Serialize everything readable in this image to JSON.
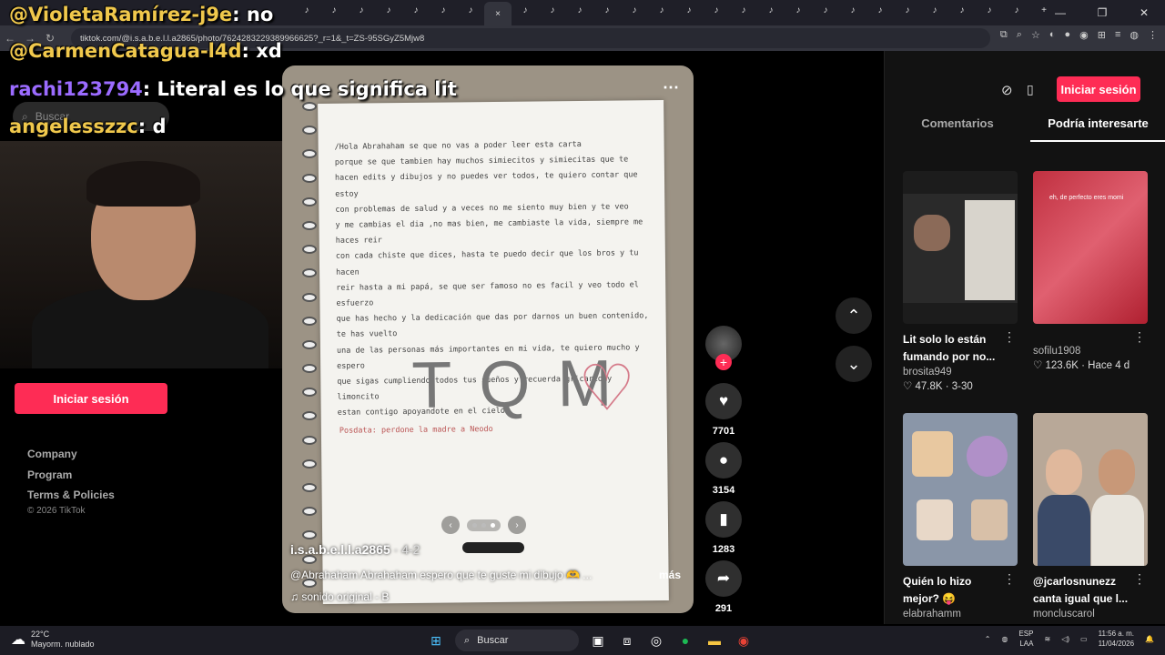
{
  "browser": {
    "url": "tiktok.com/@i.s.a.b.e.l.l.a2865/photo/7624283229389966625?_r=1&_t=ZS-95SGyZ5Mjw8",
    "tab_close": "×",
    "new_tab": "+",
    "controls": [
      "—",
      "❐",
      "✕"
    ]
  },
  "chat": [
    {
      "user": "@VioletaRamírez-j9e",
      "message": ": no"
    },
    {
      "user": "@CarmenCatagua-l4d",
      "message": ": xd"
    },
    {
      "user": "rachi123794",
      "message": ": Literal es lo que significa lit"
    },
    {
      "user": "angelesszzc",
      "message": ": d"
    }
  ],
  "left": {
    "search_placeholder": "Buscar",
    "login_label": "Iniciar sesión",
    "footer": [
      "Company",
      "Program",
      "Terms & Policies"
    ],
    "copyright": "© 2026 TikTok"
  },
  "post": {
    "author": "i.s.a.b.e.l.l.a2865",
    "date": " · 4-2",
    "description": "@Abrahaham Abrahaham espero que te guste mi dibujo 🫶 ...",
    "more": "más",
    "music": "sonido original - B",
    "letter_lines": [
      "/Hola Abrahaham se que no vas a poder leer esta carta",
      "porque se que tambien hay muchos simiecitos y simiecitas que te",
      "hacen edits y dibujos y no puedes ver todos, te quiero contar que estoy",
      "con problemas de salud y a veces no me siento muy bien y te veo",
      "y me cambias el dia ,no mas bien, me cambiaste la vida, siempre me haces reir",
      "con cada chiste que dices, hasta te puedo decir que los bros y tu hacen",
      "reir hasta a mi papá, se que ser famoso no es facil y veo todo el esfuerzo",
      "que has hecho y la dedicación que das por darnos un buen contenido, te has vuelto",
      "una de las personas más importantes en mi vida, te quiero mucho y espero",
      "que sigas cumpliendo todos tus sueños y recuerda gricario y limoncito",
      "estan contigo apoyandote en el cielo."
    ],
    "big_text": "TQM",
    "heart": "♡",
    "posdata": "Posdata: perdone la madre a Neodo"
  },
  "actions": {
    "likes": "7701",
    "comments": "3154",
    "saves": "1283",
    "shares": "291",
    "follow_plus": "+"
  },
  "sidebar": {
    "login_label": "Iniciar sesión",
    "tab_comments": "Comentarios",
    "tab_related": "Podría interesarte",
    "cards": [
      {
        "title": "Lit solo lo están fumando por no...",
        "author": "brosita949",
        "stats": "♡ 47.8K · 3-30"
      },
      {
        "title": "",
        "author": "sofilu1908",
        "stats": "♡ 123.6K · Hace 4 d",
        "overlay": "eh, de perfecto eres momi"
      },
      {
        "title": "Quién lo hizo mejor? 😝",
        "author": "elabrahamm",
        "stats": ""
      },
      {
        "title": "@jcarlosnunezz canta igual que l...",
        "author": "moncluscarol",
        "stats": ""
      }
    ]
  },
  "taskbar": {
    "temp": "22°C",
    "weather": "Mayorm. nublado",
    "search": "Buscar",
    "lang": "ESP",
    "lang2": "LAA",
    "time": "11:56 a. m.",
    "date": "11/04/2026"
  }
}
